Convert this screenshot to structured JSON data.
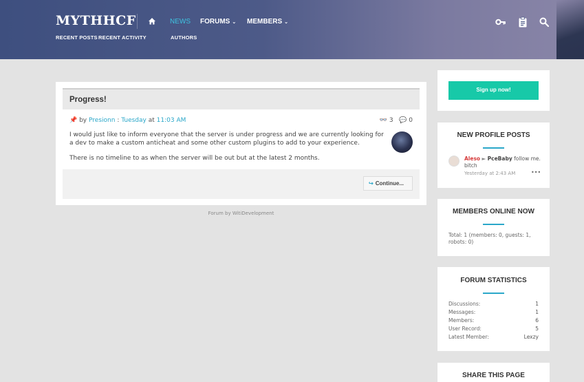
{
  "header": {
    "logo": "MYTHHCF",
    "sub_links": [
      "RECENT POSTS",
      "RECENT ACTIVITY"
    ],
    "nav": {
      "news": "NEWS",
      "forums": "FORUMS",
      "members": "MEMBERS"
    },
    "news_sub": "AUTHORS",
    "icons": [
      "home-icon",
      "key-icon",
      "clipboard-icon",
      "search-icon"
    ],
    "accent": "#3ec3e0"
  },
  "thread": {
    "title": "Progress!",
    "by_label": "by",
    "author": "Presionn",
    "day": "Tuesday",
    "at_label": "at",
    "time": "11:03 AM",
    "views": "3",
    "replies": "0",
    "body_p1": "I would just like to inform everyone that the server is under progress and we are currently looking for a dev to make a custom anticheat and some other custom plugins to add to your experience.",
    "body_p2": "There is no timeline to as when the server will be out but at the latest 2 months.",
    "continue_label": "Continue..."
  },
  "footer": {
    "credit": "Forum by WitiDevelopment"
  },
  "sidebar": {
    "signup_label": "Sign up now!",
    "signup_color": "#17c9a8",
    "profile_posts": {
      "title": "NEW PROFILE POSTS",
      "user": "Aleso",
      "arrow": "►",
      "target": "PceBaby",
      "message": "follow me. bitch",
      "time": "Yesterday at 2:43 AM",
      "more": "•••"
    },
    "online": {
      "title": "MEMBERS ONLINE NOW",
      "text": "Total: 1 (members: 0, guests: 1, robots: 0)"
    },
    "stats": {
      "title": "FORUM STATISTICS",
      "rows": [
        {
          "label": "Discussions:",
          "value": "1"
        },
        {
          "label": "Messages:",
          "value": "1"
        },
        {
          "label": "Members:",
          "value": "6"
        },
        {
          "label": "User Record:",
          "value": "5"
        },
        {
          "label": "Latest Member:",
          "value": "Lexzy"
        }
      ]
    },
    "share": {
      "title": "SHARE THIS PAGE"
    }
  }
}
